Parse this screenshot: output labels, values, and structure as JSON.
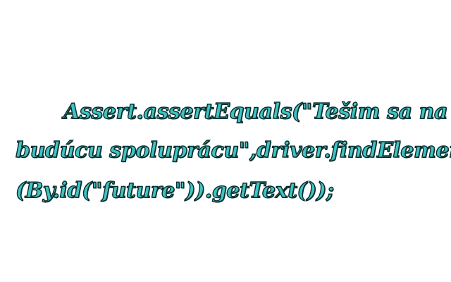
{
  "text": {
    "line1": "Assert.assertEquals(\"Tešim sa na",
    "line2": "budúcu spoluprácu\",driver.findElement",
    "line3": "(By.id(\"future\")).getText());"
  }
}
